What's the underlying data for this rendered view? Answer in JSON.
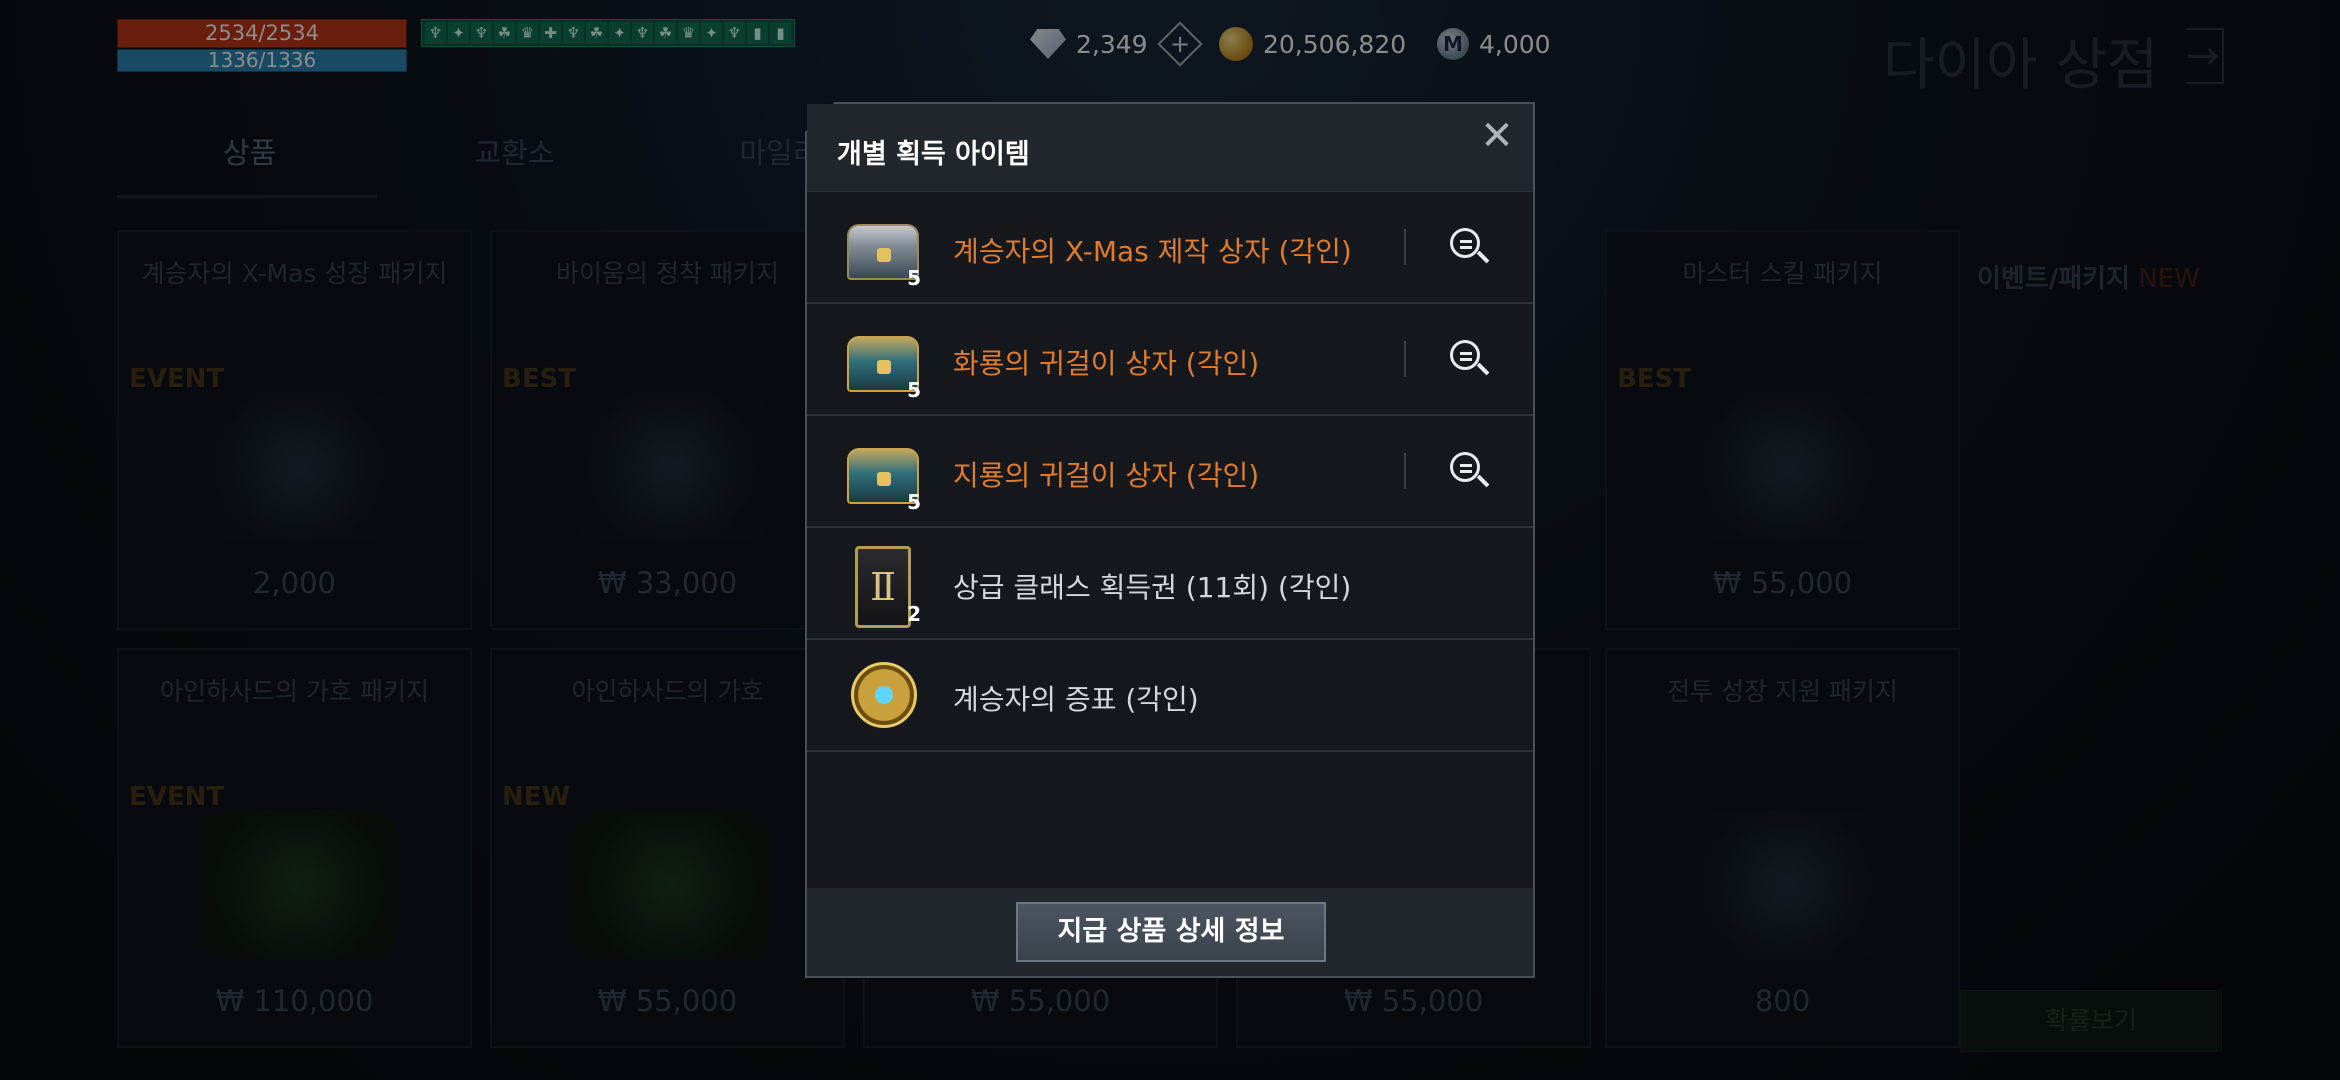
{
  "hud": {
    "hp": "2534/2534",
    "mp": "1336/1336",
    "buffs": [
      "♆",
      "✦",
      "♆",
      "☘",
      "♛",
      "✚",
      "♆",
      "☘",
      "✦",
      "♆",
      "☘",
      "♛",
      "✦",
      "♆",
      "▮",
      "▮"
    ]
  },
  "currency": {
    "diamond": "2,349",
    "diamond_plus": "+",
    "gold": "20,506,820",
    "mileage_icon": "M",
    "mileage": "4,000"
  },
  "shop": {
    "title": "다이아 상점",
    "arrow": "→",
    "tabs": [
      "상품",
      "교환소",
      "마일리"
    ],
    "cards": [
      {
        "title": "계승자의 X-Mas 성장 패키지",
        "badge": "EVENT",
        "price": "2,000"
      },
      {
        "title": "바이움의 정착 패키지",
        "badge": "BEST",
        "price": "₩ 33,000"
      },
      {
        "title": "마스터 스킬 패키지",
        "badge": "BEST",
        "price": "₩ 55,000"
      },
      {
        "title": "아인하사드의 가호 패키지",
        "badge": "EVENT",
        "price": "₩ 110,000"
      },
      {
        "title": "아인하사드의 가호",
        "badge": "NEW",
        "price": "₩ 55,000"
      },
      {
        "title": "",
        "badge": "",
        "price": "₩ 55,000"
      },
      {
        "title": "",
        "badge": "",
        "price": "₩ 55,000"
      },
      {
        "title": "전투 성장 지원 패키지",
        "badge": "",
        "price": "800"
      }
    ],
    "side_title": "이벤트/패키지",
    "side_new": "NEW",
    "side_button": "확률보기"
  },
  "modal": {
    "title": "개별 획득 아이템",
    "close": "✕",
    "items": [
      {
        "name": "계승자의 X-Mas 제작 상자 (각인)",
        "qty": "5",
        "icon": "chest-icon",
        "color": "#e07a2c"
      },
      {
        "name": "화룡의 귀걸이 상자 (각인)",
        "qty": "5",
        "icon": "chest-icon",
        "color": "#e07a2c"
      },
      {
        "name": "지룡의 귀걸이 상자 (각인)",
        "qty": "5",
        "icon": "chest-icon",
        "color": "#e07a2c"
      },
      {
        "name": "상급 클래스 획득권 (11회) (각인)",
        "qty": "2",
        "icon": "class-card-icon",
        "color": "#d4d8dc"
      },
      {
        "name": "계승자의 증표 (각인)",
        "qty": "",
        "icon": "emblem-icon",
        "color": "#d4d8dc"
      }
    ],
    "card_glyph": "Ⅱ",
    "detail_button": "지급 상품 상세 정보"
  }
}
